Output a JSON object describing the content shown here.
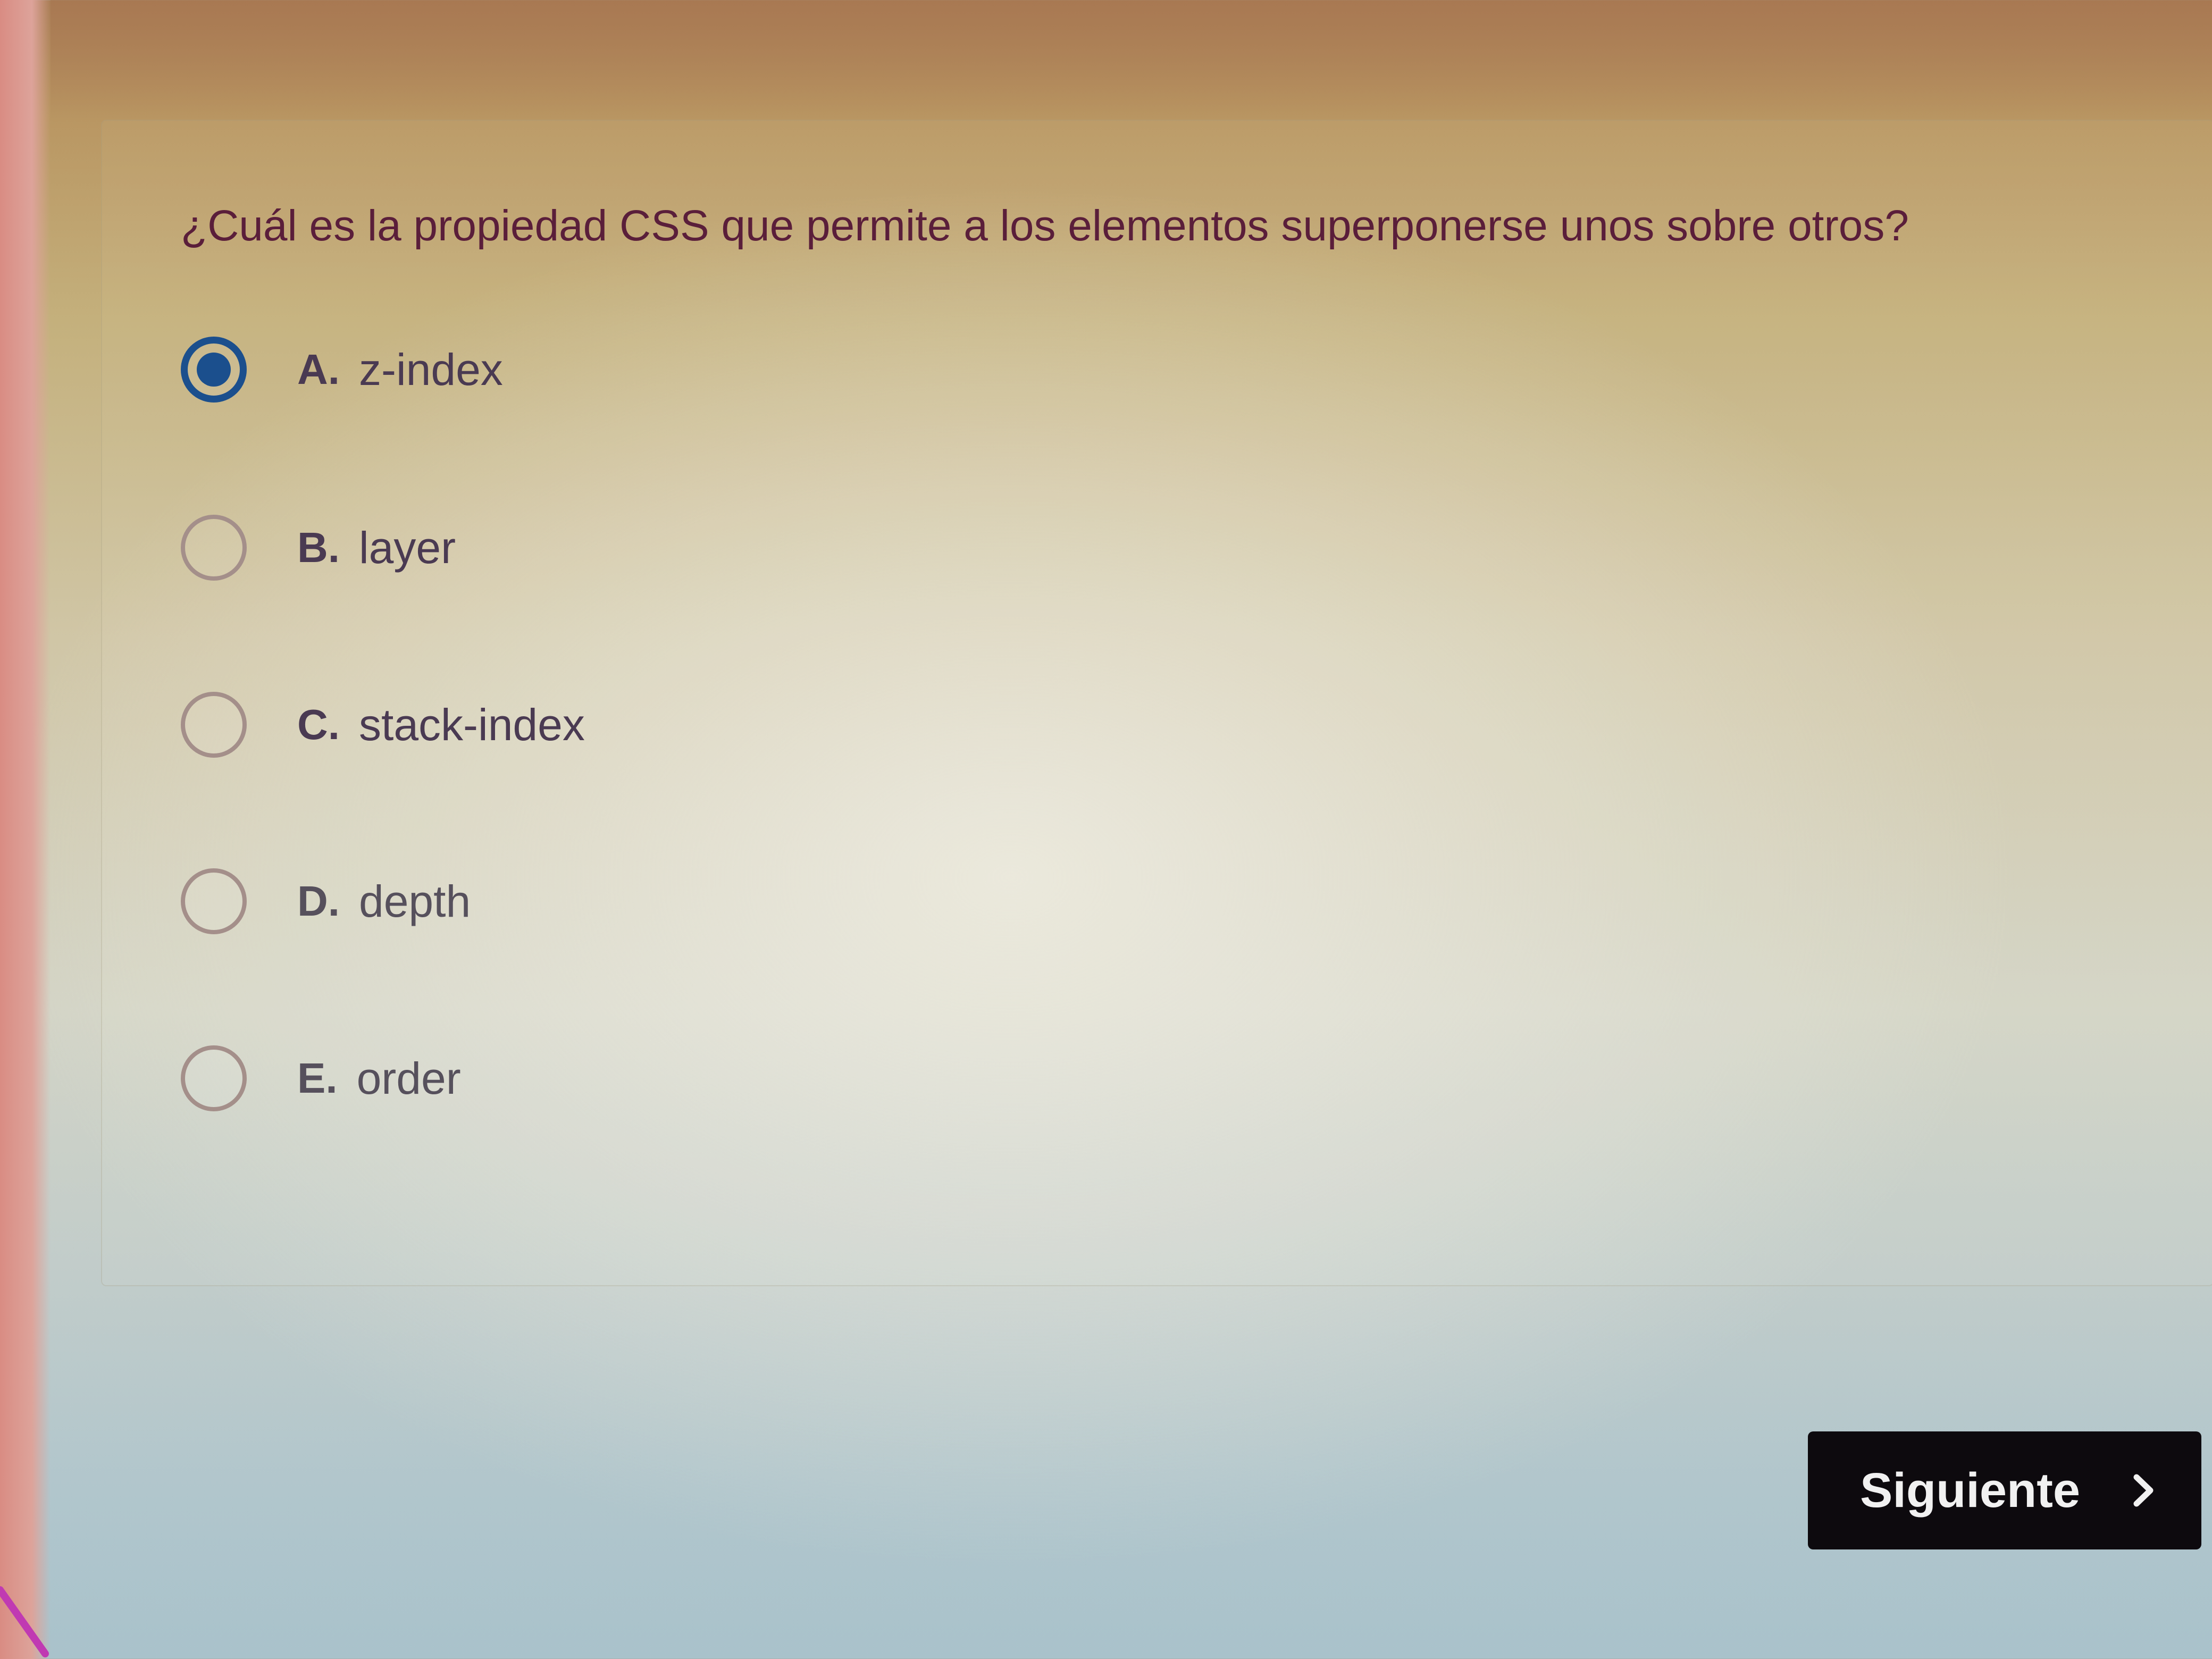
{
  "quiz": {
    "question": "¿Cuál es la propiedad CSS que permite a los elementos superponerse unos sobre otros?",
    "selected_option": "A",
    "options": [
      {
        "letter": "A.",
        "text": "z-index",
        "selected": true
      },
      {
        "letter": "B.",
        "text": "layer",
        "selected": false
      },
      {
        "letter": "C.",
        "text": "stack-index",
        "selected": false
      },
      {
        "letter": "D.",
        "text": "depth",
        "selected": false
      },
      {
        "letter": "E.",
        "text": "order",
        "selected": false
      }
    ],
    "next_button": {
      "label": "Siguiente",
      "icon": "chevron-right-icon"
    }
  },
  "colors": {
    "accent": "#1b4f8d",
    "question_text": "#5a1e3a",
    "option_text": "#4a3a52",
    "button_bg": "#0d0a0e",
    "button_text": "#f1f1f1"
  }
}
